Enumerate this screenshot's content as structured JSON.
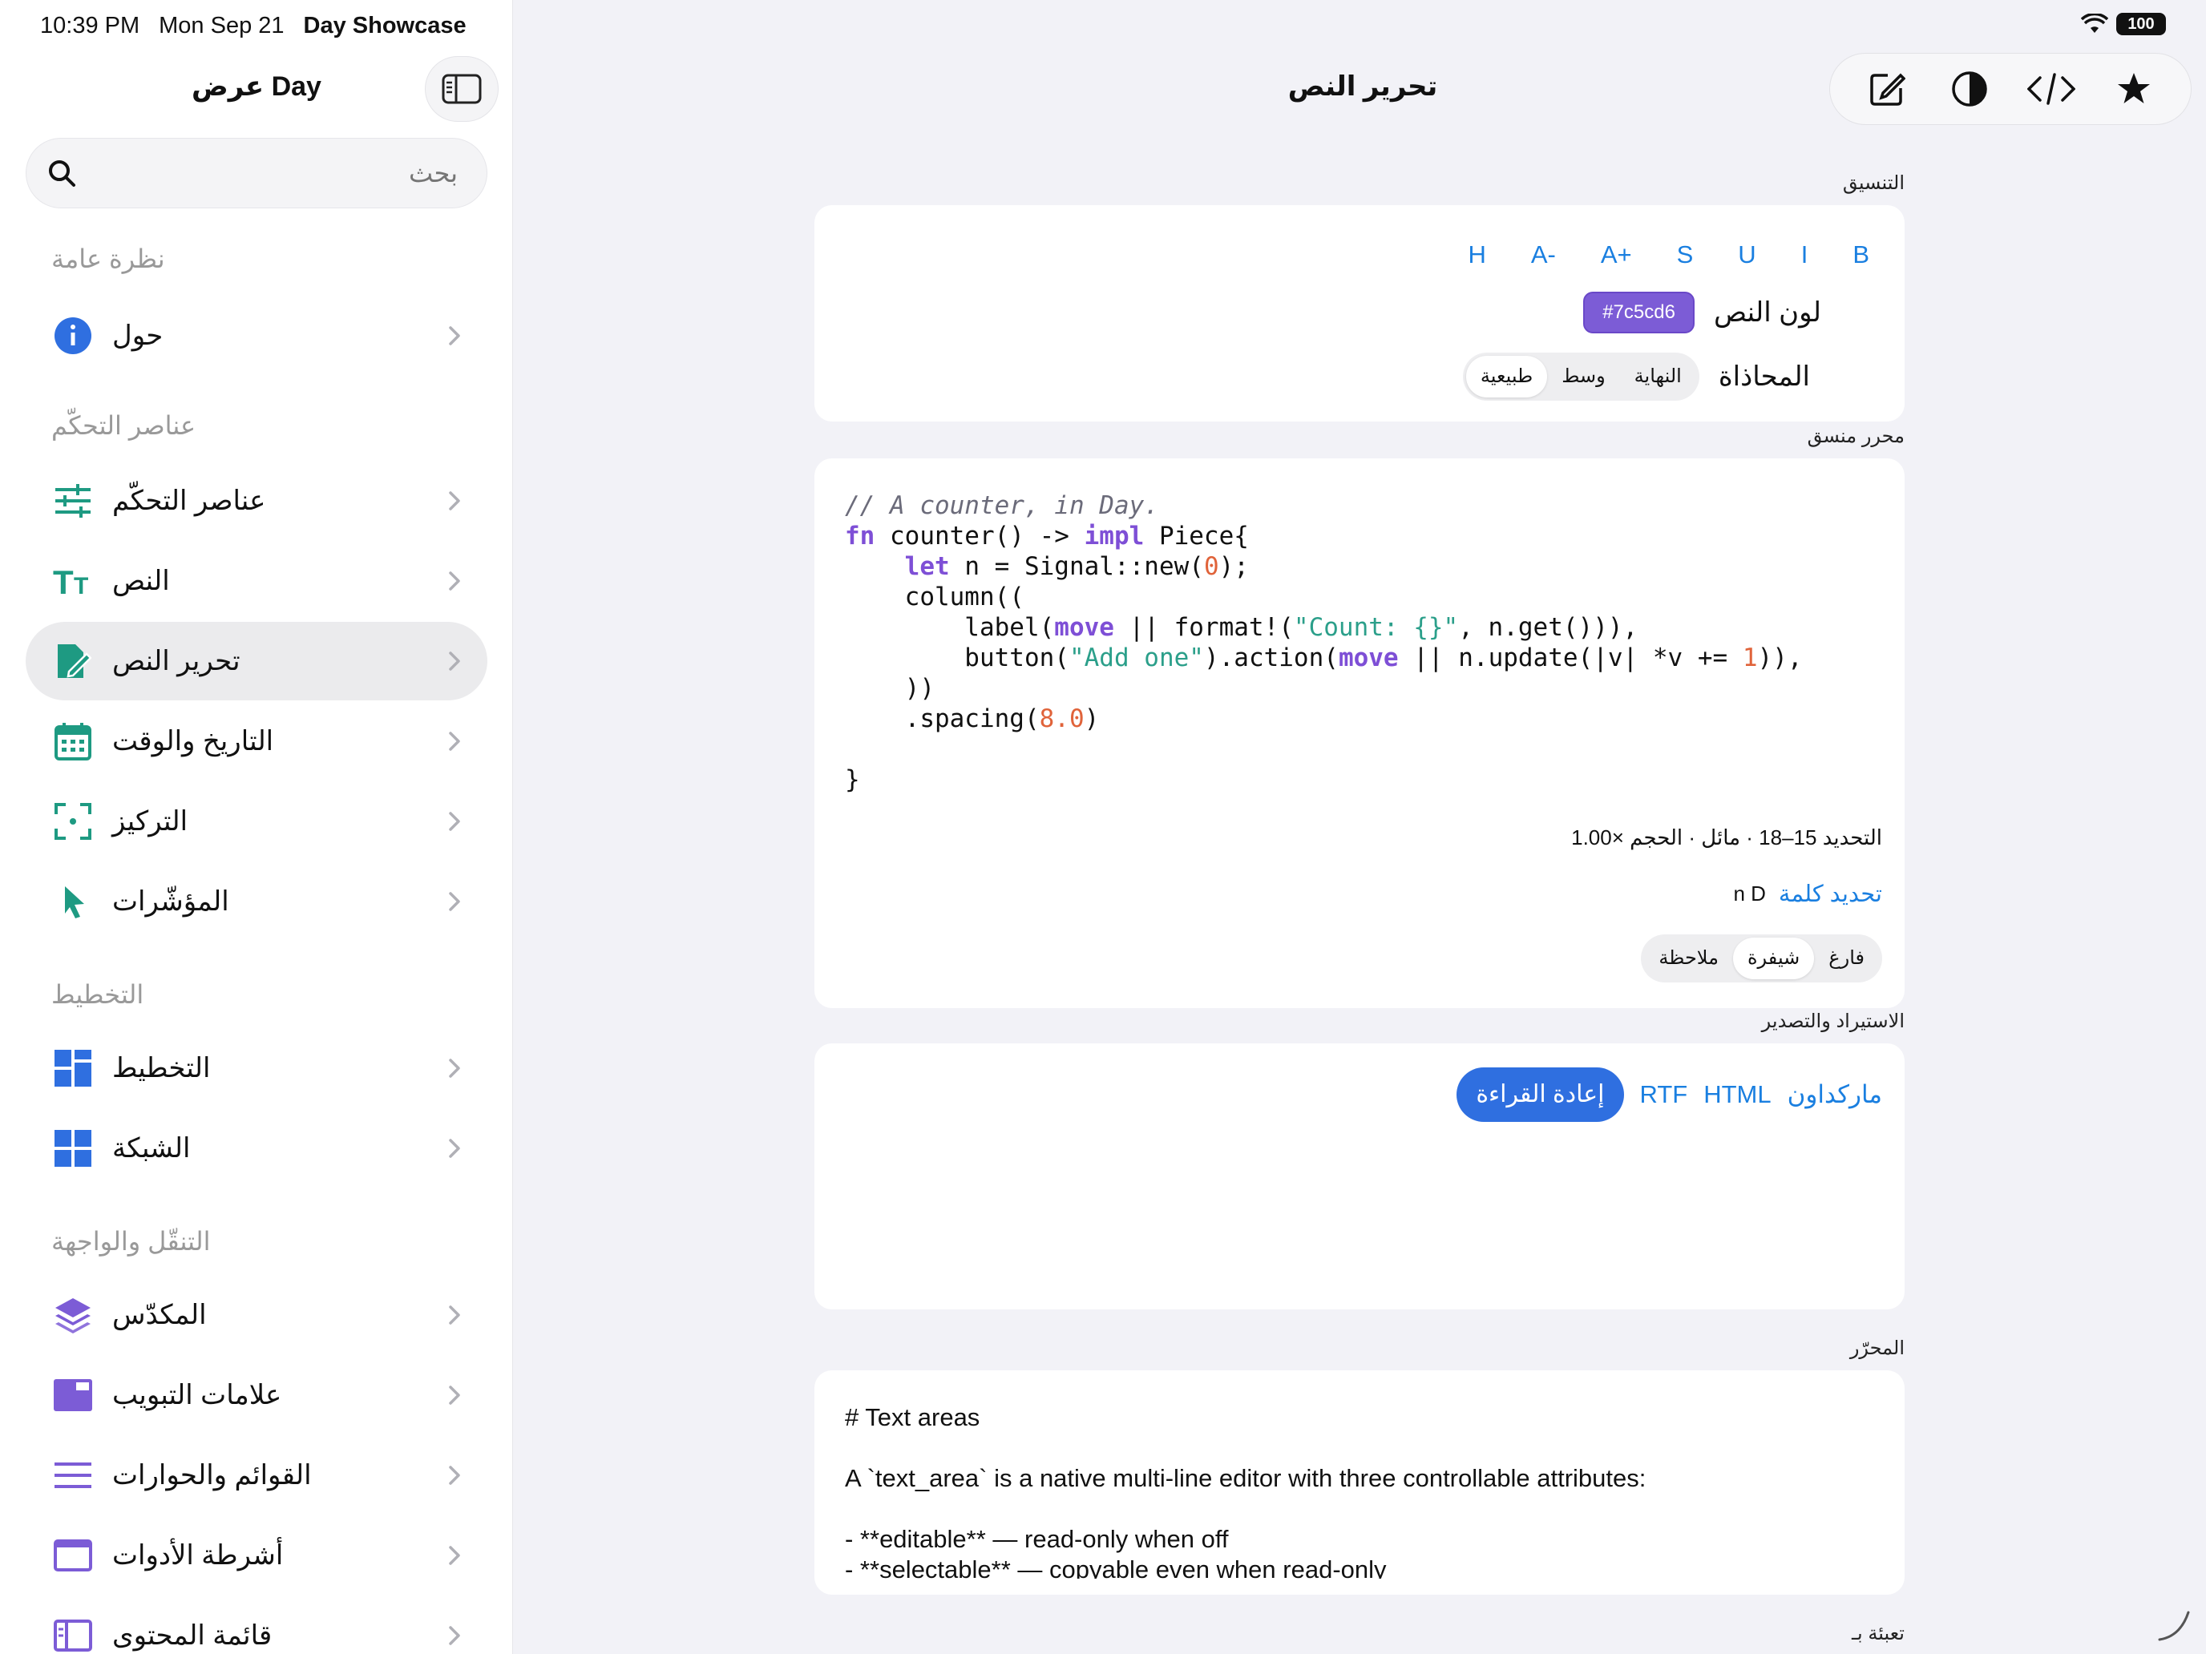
{
  "status": {
    "time": "10:39 PM",
    "date": "Mon Sep 21",
    "app": "Day Showcase",
    "battery": "100"
  },
  "sidebar": {
    "title": "عرض Day",
    "search_placeholder": "بحث",
    "sections": [
      {
        "header": "نظرة عامة",
        "items": [
          {
            "label": "حول",
            "icon": "info-icon"
          }
        ]
      },
      {
        "header": "عناصر التحكّم",
        "items": [
          {
            "label": "عناصر التحكّم",
            "icon": "sliders-icon"
          },
          {
            "label": "النص",
            "icon": "text-size-icon"
          },
          {
            "label": "تحرير النص",
            "icon": "edit-document-icon"
          },
          {
            "label": "التاريخ والوقت",
            "icon": "calendar-icon"
          },
          {
            "label": "التركيز",
            "icon": "focus-icon"
          },
          {
            "label": "المؤشّرات",
            "icon": "cursor-icon"
          }
        ]
      },
      {
        "header": "التخطيط",
        "items": [
          {
            "label": "التخطيط",
            "icon": "layout-icon"
          },
          {
            "label": "الشبكة",
            "icon": "grid-icon"
          }
        ]
      },
      {
        "header": "التنقّل والواجهة",
        "items": [
          {
            "label": "المكدّس",
            "icon": "layers-icon"
          },
          {
            "label": "علامات التبويب",
            "icon": "tabs-icon"
          },
          {
            "label": "القوائم والحوارات",
            "icon": "menu-icon"
          },
          {
            "label": "أشرطة الأدوات",
            "icon": "toolbar-icon"
          },
          {
            "label": "قائمة المحتوى",
            "icon": "content-list-icon"
          }
        ]
      }
    ],
    "active": "تحرير النص"
  },
  "main": {
    "title": "تحرير النص",
    "toolbar": [
      "compose-icon",
      "contrast-icon",
      "code-icon",
      "star-icon"
    ],
    "formatting": {
      "label": "التنسيق",
      "buttons": [
        "B",
        "I",
        "U",
        "S",
        "A+",
        "A-",
        "H"
      ],
      "text_color_label": "لون النص",
      "text_color_value": "#7c5cd6",
      "alignment_label": "المحاذاة",
      "alignment_options": [
        "طبيعية",
        "وسط",
        "النهاية"
      ],
      "alignment_selected": "طبيعية"
    },
    "rich_editor": {
      "label": "محرر منسق",
      "selection_info": "التحديد 15–18 · مائل · الحجم ×1.00",
      "select_word": "تحديد كلمة",
      "word_value": "n D",
      "modes": [
        "فارغ",
        "شيفرة",
        "ملاحظة"
      ],
      "mode_selected": "شيفرة"
    },
    "import_export": {
      "label": "الاستيراد والتصدير",
      "links": [
        "ماركداون",
        "HTML",
        "RTF"
      ],
      "reread": "إعادة القراءة"
    },
    "editor": {
      "label": "المحرّر",
      "lines": [
        "# Text areas",
        "A `text_area` is a native multi-line editor with three controllable attributes:",
        "- **editable** — read-only when off",
        "- **selectable** — copyable even when read-only"
      ]
    },
    "fill_label": "تعبئة بـ"
  },
  "colors": {
    "accent": "#1a7fe0",
    "primary": "#2f6fe0",
    "purple": "#7c5cd6",
    "teal": "#1e9a82",
    "blue": "#2f6fe0"
  }
}
